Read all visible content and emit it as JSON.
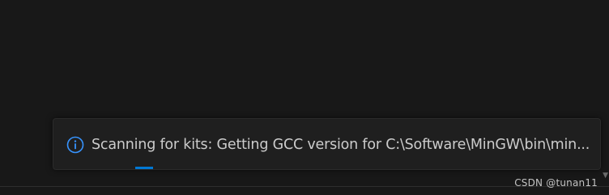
{
  "notification": {
    "icon": "info-icon",
    "message": "Scanning for kits: Getting GCC version for C:\\Software\\MinGW\\bin\\min...",
    "progress_state": "indeterminate",
    "accent_color": "#0078d4"
  },
  "watermark": {
    "text": "CSDN @tunan11"
  },
  "colors": {
    "background": "#181818",
    "notification_bg": "#1f1f1f",
    "text": "#cccccc",
    "info_icon": "#3794ff"
  }
}
